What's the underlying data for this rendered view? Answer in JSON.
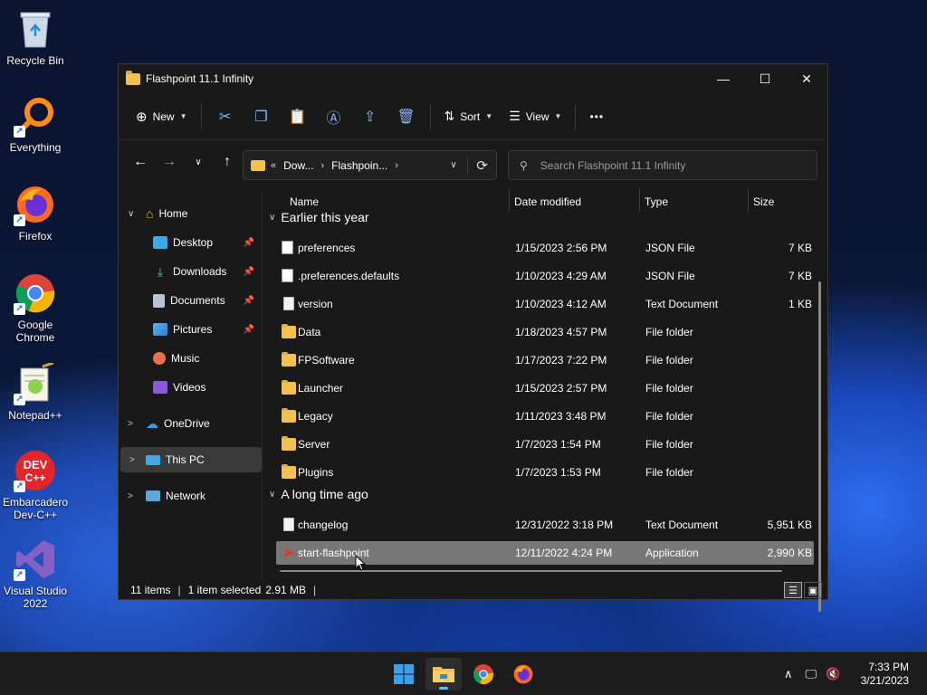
{
  "desktop": {
    "icons": [
      {
        "label": "Recycle Bin",
        "icon": "recycle-bin-icon"
      },
      {
        "label": "Everything",
        "icon": "everything-search-icon"
      },
      {
        "label": "Firefox",
        "icon": "firefox-icon"
      },
      {
        "label": "Google Chrome",
        "icon": "chrome-icon"
      },
      {
        "label": "Notepad++",
        "icon": "notepadpp-icon"
      },
      {
        "label": "Embarcadero Dev-C++",
        "icon": "devcpp-icon"
      },
      {
        "label": "Visual Studio 2022",
        "icon": "visual-studio-icon"
      }
    ],
    "devcpp_badge": "DEV\nC++"
  },
  "window": {
    "title": "Flashpoint 11.1 Infinity",
    "controls": {
      "minimize": "—",
      "maximize": "☐",
      "close": "✕"
    },
    "toolbar": {
      "new_label": "New",
      "sort_label": "Sort",
      "view_label": "View",
      "more_label": "•••"
    },
    "address": {
      "crumbs": [
        "Dow...",
        "Flashpoin..."
      ],
      "overflow": "«"
    },
    "search": {
      "placeholder": "Search Flashpoint 11.1 Infinity"
    },
    "nav": [
      {
        "label": "Home",
        "expander": "∨",
        "pinned": false
      },
      {
        "label": "Desktop",
        "pinned": true
      },
      {
        "label": "Downloads",
        "pinned": true
      },
      {
        "label": "Documents",
        "pinned": true
      },
      {
        "label": "Pictures",
        "pinned": true
      },
      {
        "label": "Music",
        "pinned": false
      },
      {
        "label": "Videos",
        "pinned": false
      },
      {
        "label": "OneDrive",
        "expander": ">",
        "pinned": false
      },
      {
        "label": "This PC",
        "expander": ">",
        "pinned": false,
        "selected": true
      },
      {
        "label": "Network",
        "expander": ">",
        "pinned": false
      }
    ],
    "columns": {
      "name": "Name",
      "date": "Date modified",
      "type": "Type",
      "size": "Size"
    },
    "groups": [
      {
        "title": "Earlier this year",
        "files": [
          {
            "name": "preferences",
            "date": "1/15/2023 2:56 PM",
            "type": "JSON File",
            "size": "7 KB",
            "kind": "json"
          },
          {
            "name": ".preferences.defaults",
            "date": "1/10/2023 4:29 AM",
            "type": "JSON File",
            "size": "7 KB",
            "kind": "json"
          },
          {
            "name": "version",
            "date": "1/10/2023 4:12 AM",
            "type": "Text Document",
            "size": "1 KB",
            "kind": "doc"
          },
          {
            "name": "Data",
            "date": "1/18/2023 4:57 PM",
            "type": "File folder",
            "size": "",
            "kind": "folder"
          },
          {
            "name": "FPSoftware",
            "date": "1/17/2023 7:22 PM",
            "type": "File folder",
            "size": "",
            "kind": "folder"
          },
          {
            "name": "Launcher",
            "date": "1/15/2023 2:57 PM",
            "type": "File folder",
            "size": "",
            "kind": "folder"
          },
          {
            "name": "Legacy",
            "date": "1/11/2023 3:48 PM",
            "type": "File folder",
            "size": "",
            "kind": "folder"
          },
          {
            "name": "Server",
            "date": "1/7/2023 1:54 PM",
            "type": "File folder",
            "size": "",
            "kind": "folder"
          },
          {
            "name": "Plugins",
            "date": "1/7/2023 1:53 PM",
            "type": "File folder",
            "size": "",
            "kind": "folder"
          }
        ]
      },
      {
        "title": "A long time ago",
        "files": [
          {
            "name": "changelog",
            "date": "12/31/2022 3:18 PM",
            "type": "Text Document",
            "size": "5,951 KB",
            "kind": "doc"
          },
          {
            "name": "start-flashpoint",
            "date": "12/11/2022 4:24 PM",
            "type": "Application",
            "size": "2,990 KB",
            "kind": "app",
            "selected": true
          }
        ]
      }
    ],
    "status": {
      "items": "11 items",
      "selection": "1 item selected",
      "size": "2.91 MB",
      "divider": "|"
    }
  },
  "taskbar": {
    "apps": [
      "windows-start-icon",
      "file-explorer-icon",
      "chrome-icon",
      "firefox-icon"
    ],
    "tray": {
      "chevron": "∧"
    },
    "time": "7:33 PM",
    "date": "3/21/2023"
  },
  "colors": {
    "accent": "#4cc2ff",
    "folder": "#f2c14e",
    "selection": "#777777",
    "window_bg": "#191919"
  }
}
